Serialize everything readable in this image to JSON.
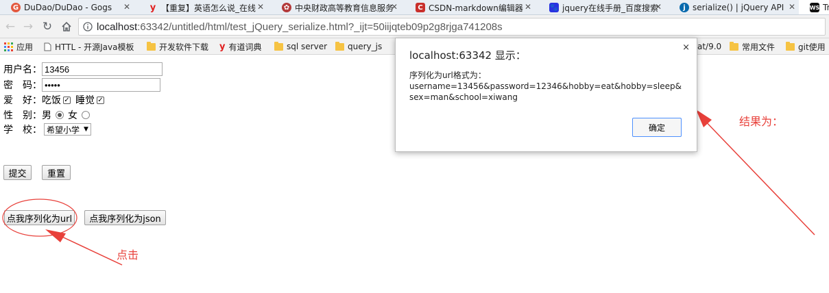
{
  "browser": {
    "tabs": [
      {
        "title": "DuDao/DuDao - Gogs",
        "icon": "gogs-icon",
        "color": "#e3593f"
      },
      {
        "title": "【重复】英语怎么说_在线",
        "icon": "youdao-icon",
        "color": "#e02020"
      },
      {
        "title": "中央财政高等教育信息服务",
        "icon": "university-icon",
        "color": "#b33a3a"
      },
      {
        "title": "CSDN-markdown编辑器",
        "icon": "csdn-icon",
        "color": "#c9302c"
      },
      {
        "title": "jquery在线手册_百度搜索",
        "icon": "baidu-icon",
        "color": "#2932e1"
      },
      {
        "title": "serialize() | jQuery API",
        "icon": "jquery-icon",
        "color": "#0769ad"
      },
      {
        "title": "Tr",
        "icon": "webstorm-icon",
        "color": "#111111"
      }
    ],
    "url_host": "localhost",
    "url_rest": ":63342/untitled/html/test_jQuery_serialize.html?_ijt=50iijqteb09p2g8rjga741208s",
    "bookmarks": [
      "应用",
      "HTTL - 开源Java模板",
      "开发软件下载",
      "有道词典",
      "sql server",
      "query_js",
      "at/9.0",
      "常用文件",
      "git使用"
    ]
  },
  "form": {
    "username_label": "用户名：",
    "username_value": "13456",
    "password_label": "密　码：",
    "password_mask": "•••••",
    "hobby_label": "爱　好：",
    "hobby_eat": "吃饭",
    "hobby_sleep": "睡觉",
    "gender_label": "性　别：",
    "gender_male": "男",
    "gender_female": "女",
    "school_label": "学　校：",
    "school_value": "希望小学",
    "submit": "提交",
    "reset": "重置",
    "to_url": "点我序列化为url",
    "to_json": "点我序列化为json"
  },
  "dialog": {
    "title": "localhost:63342 显示：",
    "message_line1": "序列化为url格式为：",
    "message_line2": "username=13456&password=12346&hobby=eat&hobby=sleep&sex=man&school=xiwang",
    "ok": "确定",
    "close": "×"
  },
  "annotations": {
    "click": "点击",
    "result": "结果为："
  },
  "colors": {
    "annotation_red": "#e8403a",
    "omnibox_border": "#cfcfcf"
  }
}
